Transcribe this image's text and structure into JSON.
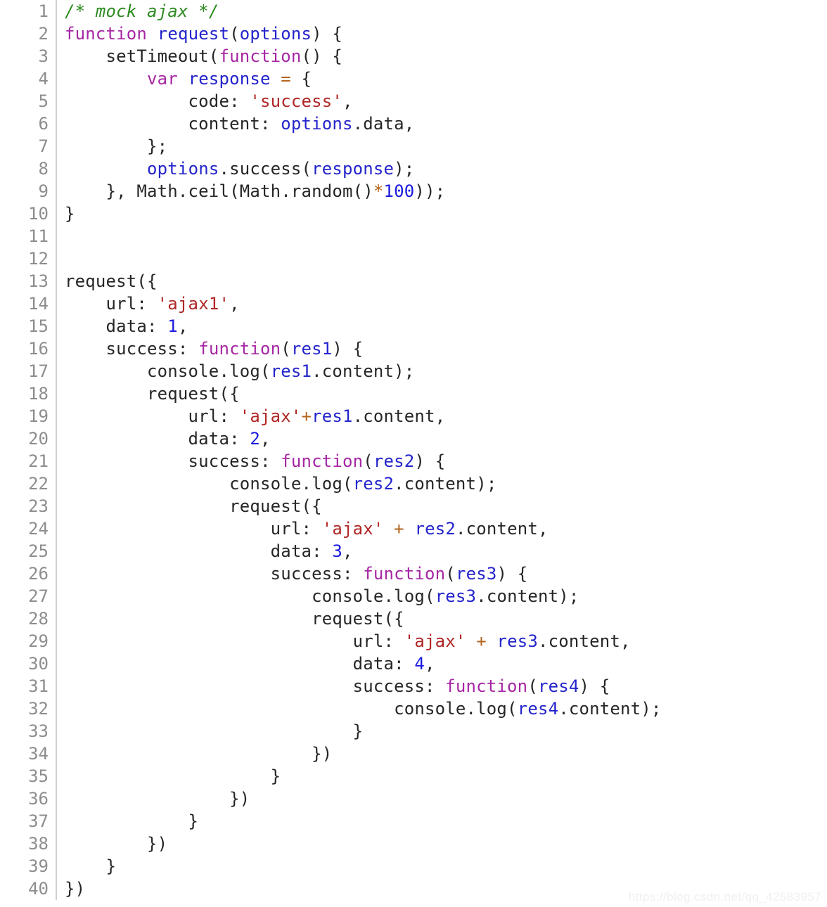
{
  "editor": {
    "language": "javascript",
    "first_line_number": 1,
    "last_line_number": 40,
    "total_lines": 40,
    "gutter_color": "#8d8d8d",
    "gutter_divider_color": "#cfcfcf",
    "background_color": "#ffffff",
    "default_text_color": "#262626"
  },
  "theme_colors": {
    "comment": "#2e8b22",
    "keyword": "#a626a4",
    "identifier": "#2424cc",
    "string": "#b02626",
    "number": "#1a1ae0",
    "operator": "#b5651d",
    "plain": "#262626"
  },
  "watermark": {
    "text": "https://blog.csdn.net/qq_42583957",
    "color": "#f0f0f0"
  },
  "lines": [
    {
      "n": "1",
      "tokens": [
        {
          "t": "comment",
          "s": "/* mock ajax */"
        }
      ]
    },
    {
      "n": "2",
      "tokens": [
        {
          "t": "keyword",
          "s": "function"
        },
        {
          "t": "plain",
          "s": " "
        },
        {
          "t": "ident",
          "s": "request"
        },
        {
          "t": "plain",
          "s": "("
        },
        {
          "t": "ident",
          "s": "options"
        },
        {
          "t": "plain",
          "s": ") {"
        }
      ]
    },
    {
      "n": "3",
      "tokens": [
        {
          "t": "plain",
          "s": "    setTimeout("
        },
        {
          "t": "keyword",
          "s": "function"
        },
        {
          "t": "plain",
          "s": "() {"
        }
      ]
    },
    {
      "n": "4",
      "tokens": [
        {
          "t": "plain",
          "s": "        "
        },
        {
          "t": "keyword",
          "s": "var"
        },
        {
          "t": "plain",
          "s": " "
        },
        {
          "t": "ident",
          "s": "response"
        },
        {
          "t": "plain",
          "s": " "
        },
        {
          "t": "operator",
          "s": "="
        },
        {
          "t": "plain",
          "s": " {"
        }
      ]
    },
    {
      "n": "5",
      "tokens": [
        {
          "t": "plain",
          "s": "            code: "
        },
        {
          "t": "string",
          "s": "'success'"
        },
        {
          "t": "plain",
          "s": ","
        }
      ]
    },
    {
      "n": "6",
      "tokens": [
        {
          "t": "plain",
          "s": "            content: "
        },
        {
          "t": "ident",
          "s": "options"
        },
        {
          "t": "plain",
          "s": ".data,"
        }
      ]
    },
    {
      "n": "7",
      "tokens": [
        {
          "t": "plain",
          "s": "        };"
        }
      ]
    },
    {
      "n": "8",
      "tokens": [
        {
          "t": "plain",
          "s": "        "
        },
        {
          "t": "ident",
          "s": "options"
        },
        {
          "t": "plain",
          "s": ".success("
        },
        {
          "t": "ident",
          "s": "response"
        },
        {
          "t": "plain",
          "s": ");"
        }
      ]
    },
    {
      "n": "9",
      "tokens": [
        {
          "t": "plain",
          "s": "    }, Math.ceil(Math.random()"
        },
        {
          "t": "operator",
          "s": "*"
        },
        {
          "t": "number",
          "s": "100"
        },
        {
          "t": "plain",
          "s": "));"
        }
      ]
    },
    {
      "n": "10",
      "tokens": [
        {
          "t": "plain",
          "s": "}"
        }
      ]
    },
    {
      "n": "11",
      "tokens": [
        {
          "t": "plain",
          "s": ""
        }
      ]
    },
    {
      "n": "12",
      "tokens": [
        {
          "t": "plain",
          "s": ""
        }
      ]
    },
    {
      "n": "13",
      "tokens": [
        {
          "t": "plain",
          "s": "request({"
        }
      ]
    },
    {
      "n": "14",
      "tokens": [
        {
          "t": "plain",
          "s": "    url: "
        },
        {
          "t": "string",
          "s": "'ajax1'"
        },
        {
          "t": "plain",
          "s": ","
        }
      ]
    },
    {
      "n": "15",
      "tokens": [
        {
          "t": "plain",
          "s": "    data: "
        },
        {
          "t": "number",
          "s": "1"
        },
        {
          "t": "plain",
          "s": ","
        }
      ]
    },
    {
      "n": "16",
      "tokens": [
        {
          "t": "plain",
          "s": "    success: "
        },
        {
          "t": "keyword",
          "s": "function"
        },
        {
          "t": "plain",
          "s": "("
        },
        {
          "t": "ident",
          "s": "res1"
        },
        {
          "t": "plain",
          "s": ") {"
        }
      ]
    },
    {
      "n": "17",
      "tokens": [
        {
          "t": "plain",
          "s": "        console.log("
        },
        {
          "t": "ident",
          "s": "res1"
        },
        {
          "t": "plain",
          "s": ".content);"
        }
      ]
    },
    {
      "n": "18",
      "tokens": [
        {
          "t": "plain",
          "s": "        request({"
        }
      ]
    },
    {
      "n": "19",
      "tokens": [
        {
          "t": "plain",
          "s": "            url: "
        },
        {
          "t": "string",
          "s": "'ajax'"
        },
        {
          "t": "operator",
          "s": "+"
        },
        {
          "t": "ident",
          "s": "res1"
        },
        {
          "t": "plain",
          "s": ".content,"
        }
      ]
    },
    {
      "n": "20",
      "tokens": [
        {
          "t": "plain",
          "s": "            data: "
        },
        {
          "t": "number",
          "s": "2"
        },
        {
          "t": "plain",
          "s": ","
        }
      ]
    },
    {
      "n": "21",
      "tokens": [
        {
          "t": "plain",
          "s": "            success: "
        },
        {
          "t": "keyword",
          "s": "function"
        },
        {
          "t": "plain",
          "s": "("
        },
        {
          "t": "ident",
          "s": "res2"
        },
        {
          "t": "plain",
          "s": ") {"
        }
      ]
    },
    {
      "n": "22",
      "tokens": [
        {
          "t": "plain",
          "s": "                console.log("
        },
        {
          "t": "ident",
          "s": "res2"
        },
        {
          "t": "plain",
          "s": ".content);"
        }
      ]
    },
    {
      "n": "23",
      "tokens": [
        {
          "t": "plain",
          "s": "                request({"
        }
      ]
    },
    {
      "n": "24",
      "tokens": [
        {
          "t": "plain",
          "s": "                    url: "
        },
        {
          "t": "string",
          "s": "'ajax'"
        },
        {
          "t": "plain",
          "s": " "
        },
        {
          "t": "operator",
          "s": "+"
        },
        {
          "t": "plain",
          "s": " "
        },
        {
          "t": "ident",
          "s": "res2"
        },
        {
          "t": "plain",
          "s": ".content,"
        }
      ]
    },
    {
      "n": "25",
      "tokens": [
        {
          "t": "plain",
          "s": "                    data: "
        },
        {
          "t": "number",
          "s": "3"
        },
        {
          "t": "plain",
          "s": ","
        }
      ]
    },
    {
      "n": "26",
      "tokens": [
        {
          "t": "plain",
          "s": "                    success: "
        },
        {
          "t": "keyword",
          "s": "function"
        },
        {
          "t": "plain",
          "s": "("
        },
        {
          "t": "ident",
          "s": "res3"
        },
        {
          "t": "plain",
          "s": ") {"
        }
      ]
    },
    {
      "n": "27",
      "tokens": [
        {
          "t": "plain",
          "s": "                        console.log("
        },
        {
          "t": "ident",
          "s": "res3"
        },
        {
          "t": "plain",
          "s": ".content);"
        }
      ]
    },
    {
      "n": "28",
      "tokens": [
        {
          "t": "plain",
          "s": "                        request({"
        }
      ]
    },
    {
      "n": "29",
      "tokens": [
        {
          "t": "plain",
          "s": "                            url: "
        },
        {
          "t": "string",
          "s": "'ajax'"
        },
        {
          "t": "plain",
          "s": " "
        },
        {
          "t": "operator",
          "s": "+"
        },
        {
          "t": "plain",
          "s": " "
        },
        {
          "t": "ident",
          "s": "res3"
        },
        {
          "t": "plain",
          "s": ".content,"
        }
      ]
    },
    {
      "n": "30",
      "tokens": [
        {
          "t": "plain",
          "s": "                            data: "
        },
        {
          "t": "number",
          "s": "4"
        },
        {
          "t": "plain",
          "s": ","
        }
      ]
    },
    {
      "n": "31",
      "tokens": [
        {
          "t": "plain",
          "s": "                            success: "
        },
        {
          "t": "keyword",
          "s": "function"
        },
        {
          "t": "plain",
          "s": "("
        },
        {
          "t": "ident",
          "s": "res4"
        },
        {
          "t": "plain",
          "s": ") {"
        }
      ]
    },
    {
      "n": "32",
      "tokens": [
        {
          "t": "plain",
          "s": "                                console.log("
        },
        {
          "t": "ident",
          "s": "res4"
        },
        {
          "t": "plain",
          "s": ".content);"
        }
      ]
    },
    {
      "n": "33",
      "tokens": [
        {
          "t": "plain",
          "s": "                            }"
        }
      ]
    },
    {
      "n": "34",
      "tokens": [
        {
          "t": "plain",
          "s": "                        })"
        }
      ]
    },
    {
      "n": "35",
      "tokens": [
        {
          "t": "plain",
          "s": "                    }"
        }
      ]
    },
    {
      "n": "36",
      "tokens": [
        {
          "t": "plain",
          "s": "                })"
        }
      ]
    },
    {
      "n": "37",
      "tokens": [
        {
          "t": "plain",
          "s": "            }"
        }
      ]
    },
    {
      "n": "38",
      "tokens": [
        {
          "t": "plain",
          "s": "        })"
        }
      ]
    },
    {
      "n": "39",
      "tokens": [
        {
          "t": "plain",
          "s": "    }"
        }
      ]
    },
    {
      "n": "40",
      "tokens": [
        {
          "t": "plain",
          "s": "})"
        }
      ]
    }
  ]
}
